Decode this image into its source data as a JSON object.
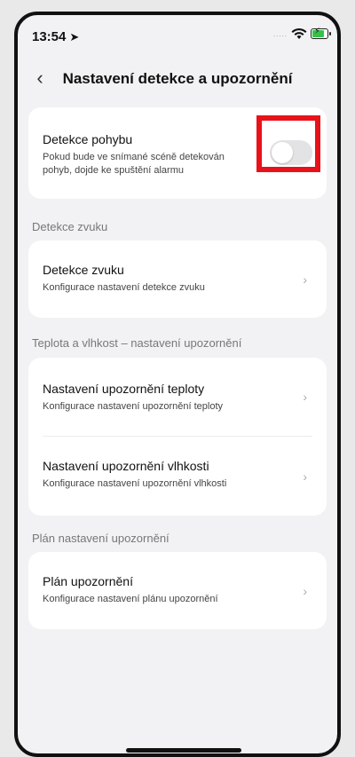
{
  "status_bar": {
    "time": "13:54",
    "signal": "....."
  },
  "header": {
    "back_glyph": "‹",
    "title": "Nastavení detekce a upozornění"
  },
  "motion": {
    "title": "Detekce pohybu",
    "subtitle": "Pokud bude ve snímané scéně detekován pohyb, dojde ke spuštění alarmu",
    "enabled": false
  },
  "sections": {
    "sound_header": "Detekce zvuku",
    "temp_header": "Teplota a vlhkost – nastavení upozornění",
    "plan_header": "Plán nastavení upozornění"
  },
  "sound": {
    "title": "Detekce zvuku",
    "subtitle": "Konfigurace nastavení detekce zvuku"
  },
  "temperature": {
    "title": "Nastavení upozornění teploty",
    "subtitle": "Konfigurace nastavení upozornění teploty"
  },
  "humidity": {
    "title": "Nastavení upozornění vlhkosti",
    "subtitle": "Konfigurace nastavení upozornění vlhkosti"
  },
  "plan": {
    "title": "Plán upozornění",
    "subtitle": "Konfigurace nastavení plánu upozornění"
  },
  "chevron": "›",
  "colors": {
    "highlight": "#e8121a",
    "battery": "#36c24a",
    "toggle_off": "#e3e3e6"
  },
  "icons": [
    "location-arrow-icon",
    "wifi-icon",
    "battery-charging-icon",
    "back-chevron-icon",
    "chevron-right-icon"
  ]
}
